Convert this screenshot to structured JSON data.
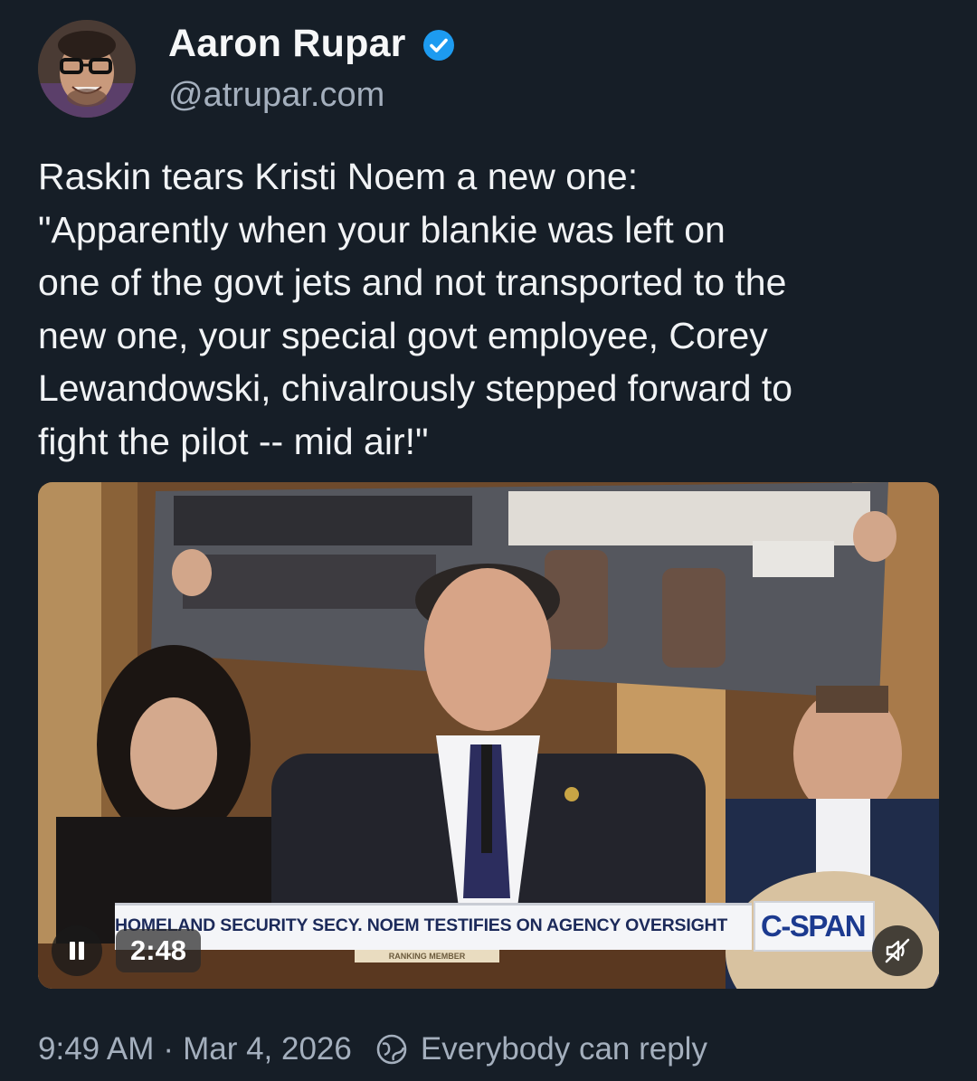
{
  "author": {
    "name": "Aaron Rupar",
    "handle": "@atrupar.com",
    "verified_icon": "verified-badge-icon",
    "verified_color": "#1d9bf0"
  },
  "post": {
    "lines": [
      "Raskin tears Kristi Noem a new one:",
      "\"Apparently when your blankie was left on",
      "one of the govt jets and not transported to the",
      "new one, your special govt employee, Corey",
      "Lewandowski, chivalrously stepped forward to",
      "fight the pilot -- mid air!\""
    ]
  },
  "video": {
    "chyron": "HOMELAND SECURITY SECY. NOEM TESTIFIES ON AGENCY OVERSIGHT",
    "chyron_sub": "RANKING MEMBER",
    "network": "C-SPAN",
    "duration": "2:48",
    "pause_icon": "pause-icon",
    "mute_icon": "muted-speaker-icon"
  },
  "footer": {
    "time": "9:49 AM",
    "separator": "·",
    "date": "Mar 4, 2026",
    "reply_icon": "globe-icon",
    "reply_setting": "Everybody can reply"
  },
  "colors": {
    "background": "#161e27",
    "text_primary": "#f1f3f5",
    "text_secondary": "#a4afbd",
    "cspan_blue": "#1c3a8f"
  }
}
